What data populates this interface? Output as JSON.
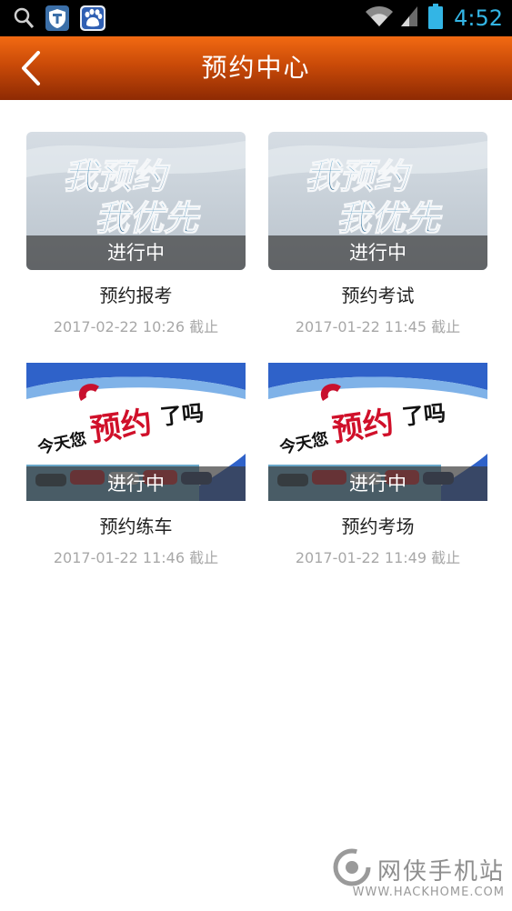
{
  "status_bar": {
    "time": "4:52",
    "left_icons": [
      "search-icon",
      "shield-app-icon",
      "baidu-paw-icon"
    ],
    "right_icons": [
      "wifi-icon",
      "signal-icon",
      "battery-icon"
    ],
    "clock_color": "#33b5e5"
  },
  "header": {
    "title": "预约中心",
    "back_icon": "chevron-left-icon",
    "gradient": [
      "#f26a12",
      "#8e2a03"
    ]
  },
  "cards": [
    {
      "image_text_line1": "我预约",
      "image_text_line2": "我优先",
      "status": "进行中",
      "title": "预约报考",
      "deadline": "2017-02-22 10:26 截止"
    },
    {
      "image_text_line1": "我预约",
      "image_text_line2": "我优先",
      "status": "进行中",
      "title": "预约考试",
      "deadline": "2017-01-22 11:45 截止"
    },
    {
      "image_text_prefix": "今天您",
      "image_text_highlight": "预约",
      "image_text_suffix": "了吗",
      "status": "进行中",
      "title": "预约练车",
      "deadline": "2017-01-22 11:46 截止"
    },
    {
      "image_text_prefix": "今天您",
      "image_text_highlight": "预约",
      "image_text_suffix": "了吗",
      "status": "进行中",
      "title": "预约考场",
      "deadline": "2017-01-22 11:49 截止"
    }
  ],
  "watermark": {
    "name": "网侠手机站",
    "url": "WWW.HACKHOME.COM"
  }
}
